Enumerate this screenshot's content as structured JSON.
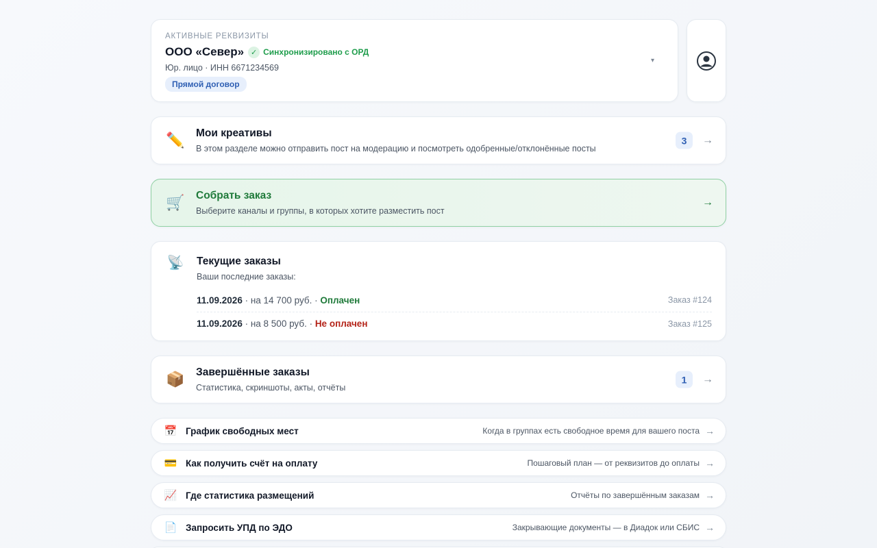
{
  "requisites": {
    "label": "АКТИВНЫЕ РЕКВИЗИТЫ",
    "name": "ООО «Север»",
    "sync_text": "Синхронизировано с ОРД",
    "meta": "Юр. лицо · ИНН 6671234569",
    "tag": "Прямой договор",
    "dropdown_icon": "▾"
  },
  "avatar": {
    "icon": "user-circle-icon"
  },
  "creatives": {
    "icon": "✏️",
    "title": "Мои креативы",
    "desc": "В этом разделе можно отправить пост на модерацию и посмотреть одобренные/отклонённые посты",
    "count": "3",
    "arrow": "→"
  },
  "build_order": {
    "icon": "🛒",
    "title": "Собрать заказ",
    "desc": "Выберите каналы и группы, в которых хотите разместить пост",
    "arrow": "→"
  },
  "current_orders": {
    "icon": "📡",
    "title": "Текущие заказы",
    "subtitle": "Ваши последние заказы:",
    "items": [
      {
        "date": "11.09.2026",
        "amount": " · на 14 700 руб. · ",
        "status": "Оплачен",
        "number": "Заказ #124"
      },
      {
        "date": "11.09.2026",
        "amount": " · на 8 500 руб. · ",
        "status": "Не оплачен",
        "number": "Заказ #125"
      }
    ]
  },
  "completed": {
    "icon": "📦",
    "title": "Завершённые заказы",
    "desc": "Статистика, скриншоты, акты, отчёты",
    "count": "1",
    "arrow": "→"
  },
  "links": [
    {
      "icon": "📅",
      "title": "График свободных мест",
      "hint": "Когда в группах есть свободное время для вашего поста",
      "arrow": "→"
    },
    {
      "icon": "💳",
      "title": "Как получить счёт на оплату",
      "hint": "Пошаговый план — от реквизитов до оплаты",
      "arrow": "→"
    },
    {
      "icon": "📈",
      "title": "Где статистика размещений",
      "hint": "Отчёты по завершённым заказам",
      "arrow": "→"
    },
    {
      "icon": "📄",
      "title": "Запросить УПД по ЭДО",
      "hint": "Закрывающие документы — в Диадок или СБИС",
      "arrow": "→"
    }
  ]
}
